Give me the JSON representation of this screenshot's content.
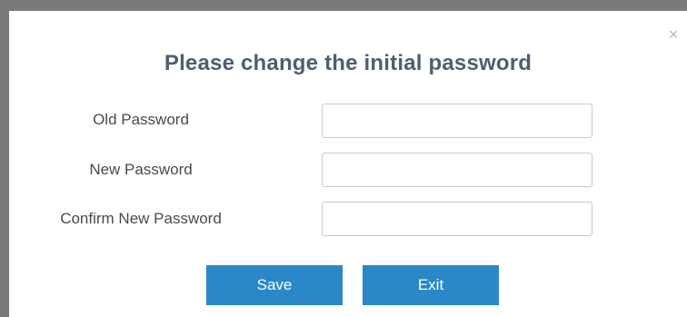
{
  "dialog": {
    "title": "Please change the initial password",
    "close_glyph": "×"
  },
  "fields": [
    {
      "label": "Old Password",
      "value": "",
      "type": "password"
    },
    {
      "label": "New Password",
      "value": "",
      "type": "password"
    },
    {
      "label": "Confirm New Password",
      "value": "",
      "type": "password"
    }
  ],
  "buttons": {
    "save_label": "Save",
    "exit_label": "Exit"
  },
  "colors": {
    "title": "#4d5f70",
    "button": "#2a87c8",
    "backdrop": "#7a7a7a"
  }
}
